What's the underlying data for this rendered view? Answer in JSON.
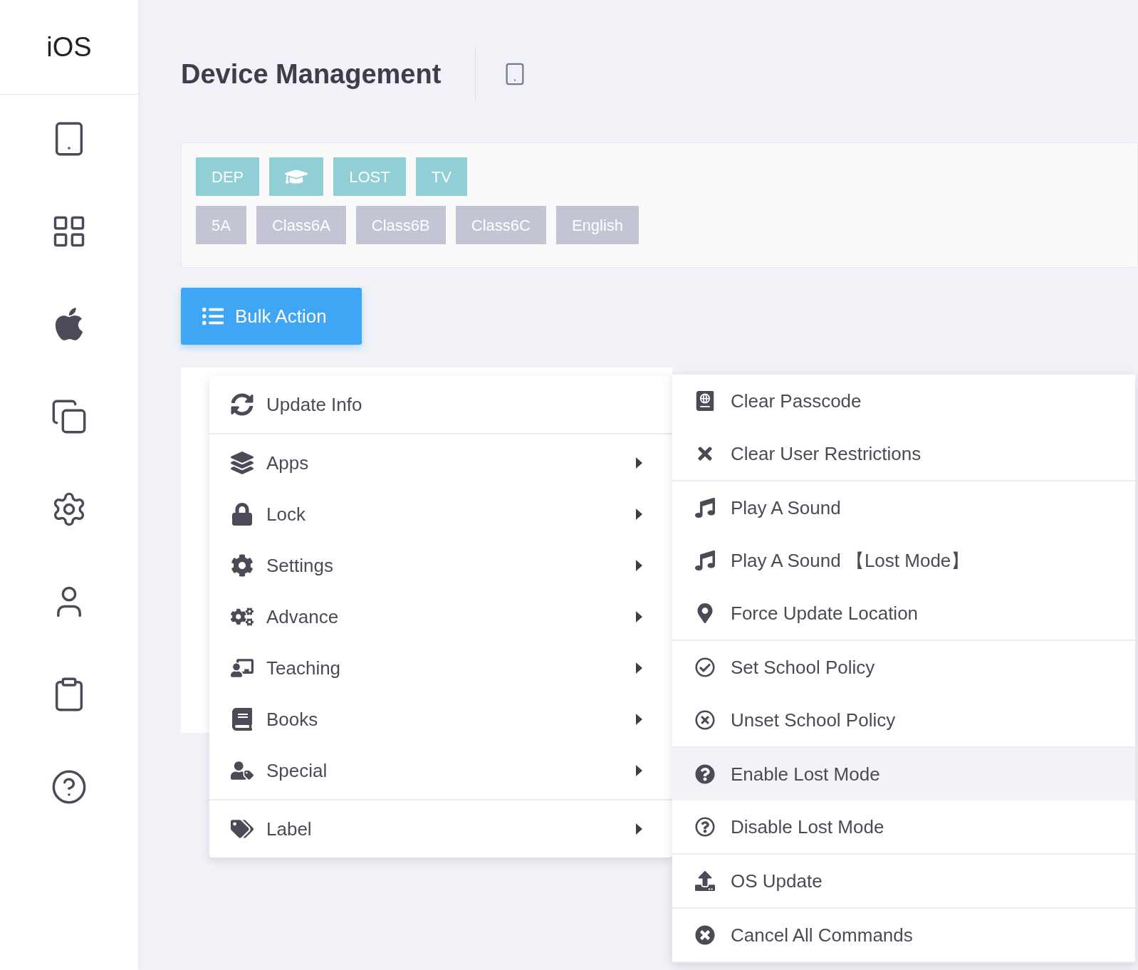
{
  "sidebar": {
    "title": "iOS"
  },
  "header": {
    "title": "Device Management"
  },
  "tag_rows": [
    {
      "color": "#8fcfd5",
      "tags": [
        {
          "kind": "text",
          "label": "DEP"
        },
        {
          "kind": "icon"
        },
        {
          "kind": "text",
          "label": "LOST"
        },
        {
          "kind": "text",
          "label": "TV"
        }
      ]
    },
    {
      "color": "#c3c4d4",
      "tags": [
        {
          "kind": "text",
          "label": "5A"
        },
        {
          "kind": "text",
          "label": "Class6A"
        },
        {
          "kind": "text",
          "label": "Class6B"
        },
        {
          "kind": "text",
          "label": "Class6C"
        },
        {
          "kind": "text",
          "label": "English"
        }
      ]
    }
  ],
  "bulk_action": {
    "label": "Bulk Action"
  },
  "menu": {
    "groups": [
      {
        "items": [
          {
            "label": "Update Info",
            "submenu": false
          }
        ]
      },
      {
        "items": [
          {
            "label": "Apps",
            "submenu": true
          },
          {
            "label": "Lock",
            "submenu": true
          },
          {
            "label": "Settings",
            "submenu": true
          },
          {
            "label": "Advance",
            "submenu": true
          },
          {
            "label": "Teaching",
            "submenu": true
          },
          {
            "label": "Books",
            "submenu": true
          },
          {
            "label": "Special",
            "submenu": true
          }
        ]
      },
      {
        "items": [
          {
            "label": "Label",
            "submenu": true
          }
        ]
      }
    ]
  },
  "submenu": {
    "groups": [
      {
        "items": [
          {
            "label": "Clear Passcode",
            "highlighted": false
          },
          {
            "label": "Clear User Restrictions",
            "highlighted": false
          }
        ]
      },
      {
        "items": [
          {
            "label": "Play A Sound",
            "highlighted": false
          },
          {
            "label": "Play A Sound 【Lost Mode】",
            "highlighted": false
          },
          {
            "label": "Force Update Location",
            "highlighted": false
          }
        ]
      },
      {
        "items": [
          {
            "label": "Set School Policy",
            "highlighted": false
          },
          {
            "label": "Unset School Policy",
            "highlighted": false
          }
        ]
      },
      {
        "items": [
          {
            "label": "Enable Lost Mode",
            "highlighted": true
          },
          {
            "label": "Disable Lost Mode",
            "highlighted": false
          }
        ]
      },
      {
        "items": [
          {
            "label": "OS Update",
            "highlighted": false
          }
        ]
      },
      {
        "items": [
          {
            "label": "Cancel All Commands",
            "highlighted": false
          }
        ]
      }
    ]
  }
}
